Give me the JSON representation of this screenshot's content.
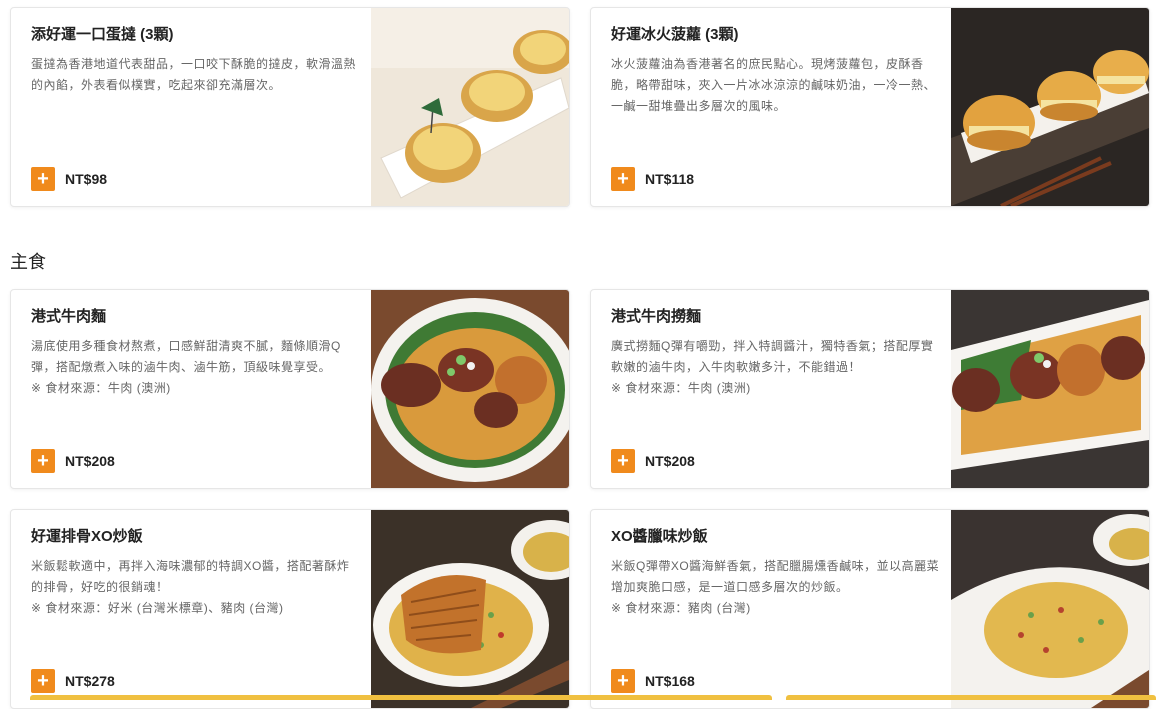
{
  "section": {
    "title": "主食"
  },
  "items": [
    {
      "title": "添好運一口蛋撻 (3顆)",
      "desc": "蛋撻為香港地道代表甜品，一口咬下酥脆的撻皮，軟滑溫熱的內餡，外表看似樸實，吃起來卻充滿層次。",
      "note": "",
      "price": "NT$98",
      "add_icon": "+"
    },
    {
      "title": "好運冰火菠蘿 (3顆)",
      "desc": "冰火菠蘿油為香港著名的庶民點心。現烤菠蘿包，皮酥香脆，略帶甜味，夾入一片冰冰涼涼的鹹味奶油，一冷一熱、一鹹一甜堆疊出多層次的風味。",
      "note": "",
      "price": "NT$118",
      "add_icon": "+"
    },
    {
      "title": "港式牛肉麵",
      "desc": "湯底使用多種食材熬煮，口感鮮甜清爽不膩，麵條順滑Q彈，搭配燉煮入味的滷牛肉、滷牛筋，頂級味覺享受。",
      "note": "※ 食材來源：牛肉 (澳洲)",
      "price": "NT$208",
      "add_icon": "+"
    },
    {
      "title": "港式牛肉撈麵",
      "desc": "廣式撈麵Q彈有嚼勁，拌入特調醬汁，獨特香氣；搭配厚實軟嫩的滷牛肉，入牛肉軟嫩多汁，不能錯過！",
      "note": "※ 食材來源：牛肉 (澳洲)",
      "price": "NT$208",
      "add_icon": "+"
    },
    {
      "title": "好運排骨XO炒飯",
      "desc": "米飯鬆軟適中，再拌入海味濃郁的特調XO醬，搭配著酥炸的排骨，好吃的很銷魂！",
      "note": "※ 食材來源：好米 (台灣米標章)、豬肉 (台灣)",
      "price": "NT$278",
      "add_icon": "+"
    },
    {
      "title": "XO醬臘味炒飯",
      "desc": "米飯Q彈帶XO醬海鮮香氣，搭配臘腸燻香鹹味，並以高麗菜增加爽脆口感，是一道口感多層次的炒飯。",
      "note": "※ 食材來源：豬肉 (台灣)",
      "price": "NT$168",
      "add_icon": "+"
    }
  ],
  "colors": {
    "accent": "#f08a1c",
    "bar": "#f0c040"
  }
}
